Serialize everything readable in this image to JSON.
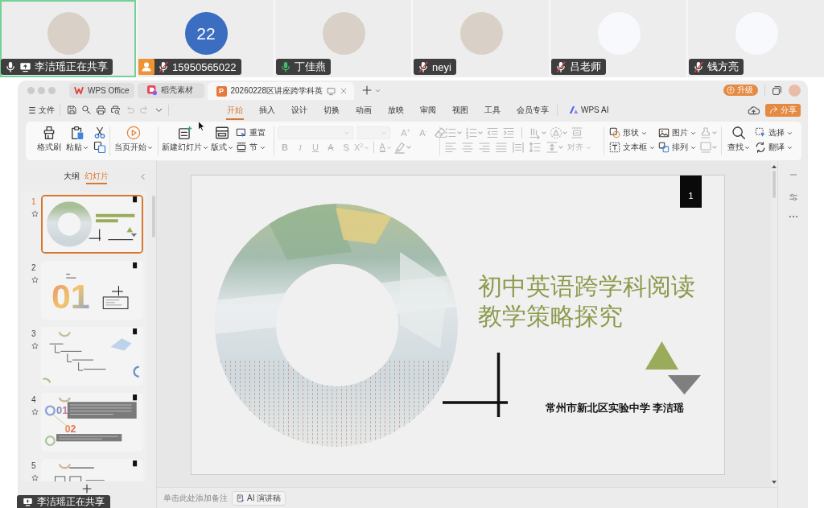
{
  "meeting": {
    "participants": [
      {
        "name": "李洁瑶正在共享",
        "selected": true,
        "badge": false,
        "muted": false,
        "speaking": false,
        "sharing": true,
        "avatar": {
          "kind": "photo"
        }
      },
      {
        "name": "15950565022",
        "selected": false,
        "badge": true,
        "muted": true,
        "speaking": false,
        "sharing": false,
        "avatar": {
          "kind": "initials",
          "text": "22"
        }
      },
      {
        "name": "丁佳燕",
        "selected": false,
        "badge": false,
        "muted": false,
        "speaking": true,
        "sharing": false,
        "avatar": {
          "kind": "photo"
        }
      },
      {
        "name": "neyi",
        "selected": false,
        "badge": false,
        "muted": true,
        "speaking": false,
        "sharing": false,
        "avatar": {
          "kind": "photo"
        }
      },
      {
        "name": "吕老师",
        "selected": false,
        "badge": false,
        "muted": true,
        "speaking": false,
        "sharing": false,
        "avatar": {
          "kind": "cartoon"
        }
      },
      {
        "name": "钱方亮",
        "selected": false,
        "badge": false,
        "muted": true,
        "speaking": false,
        "sharing": false,
        "avatar": {
          "kind": "cartoon"
        }
      }
    ],
    "share_banner": {
      "text": "李洁瑶正在共享"
    }
  },
  "wps": {
    "tabs": [
      {
        "label": "WPS Office",
        "kind": "home",
        "selected": false
      },
      {
        "label": "稻壳素材",
        "kind": "store",
        "selected": false
      },
      {
        "label": "20260228区讲座跨学科英",
        "kind": "document",
        "badge": "P",
        "selected": true
      }
    ],
    "upgrade_button": "升级",
    "file_menu": "文件",
    "menu_tabs": [
      {
        "label": "开始",
        "kind": "plain",
        "selected": true
      },
      {
        "label": "插入",
        "kind": "plain",
        "selected": false
      },
      {
        "label": "设计",
        "kind": "plain",
        "selected": false
      },
      {
        "label": "切换",
        "kind": "plain",
        "selected": false
      },
      {
        "label": "动画",
        "kind": "plain",
        "selected": false
      },
      {
        "label": "放映",
        "kind": "plain",
        "selected": false
      },
      {
        "label": "审阅",
        "kind": "plain",
        "selected": false
      },
      {
        "label": "视图",
        "kind": "plain",
        "selected": false
      },
      {
        "label": "工具",
        "kind": "plain",
        "selected": false
      },
      {
        "label": "会员专享",
        "kind": "plain",
        "selected": false
      },
      {
        "label": "WPS AI",
        "kind": "ai",
        "selected": false
      }
    ],
    "share_button": "分享",
    "ribbon": [
      {
        "kind": "clipboard",
        "disabled": false,
        "buttons": [
          {
            "label": "格式刷",
            "dropdown": false
          },
          {
            "label": "粘贴",
            "dropdown": true
          }
        ]
      },
      {
        "kind": "show",
        "disabled": false,
        "buttons": [
          {
            "label": "当页开始",
            "dropdown": true
          }
        ]
      },
      {
        "kind": "slides",
        "disabled": false,
        "buttons": [
          {
            "label": "新建幻灯片",
            "dropdown": true
          },
          {
            "label": "版式",
            "dropdown": true
          },
          {
            "label": "重置",
            "dropdown": false
          },
          {
            "label": "节",
            "dropdown": true
          }
        ]
      },
      {
        "kind": "font",
        "disabled": true,
        "buttons": [
          {
            "label": "A$^{+}$",
            "kind": "grow",
            "dropdown": false
          },
          {
            "label": "A$^{-}$",
            "kind": "shrink",
            "dropdown": false
          },
          {
            "label": "B",
            "kind": "bold",
            "dropdown": false
          },
          {
            "label": "I",
            "kind": "italic",
            "dropdown": false
          },
          {
            "label": "U",
            "kind": "underline",
            "dropdown": false
          },
          {
            "label": "A",
            "kind": "strike",
            "dropdown": false
          },
          {
            "label": "S",
            "kind": "shadow",
            "dropdown": false
          },
          {
            "label": "X$^{2}$",
            "kind": "superscript",
            "dropdown": true
          },
          {
            "label": "A",
            "kind": "color",
            "dropdown": true
          }
        ]
      },
      {
        "kind": "paragraph",
        "disabled": true,
        "buttons": [
          {
            "label": "对齐",
            "dropdown": true
          }
        ]
      },
      {
        "kind": "insert",
        "disabled": false,
        "buttons": [
          {
            "label": "形状",
            "dropdown": true
          },
          {
            "label": "文本框",
            "dropdown": true
          },
          {
            "label": "图片",
            "dropdown": true
          },
          {
            "label": "排列",
            "dropdown": true
          }
        ]
      },
      {
        "kind": "find",
        "disabled": false,
        "buttons": [
          {
            "label": "查找",
            "dropdown": true
          },
          {
            "label": "选择",
            "dropdown": true
          },
          {
            "label": "翻译",
            "dropdown": true
          }
        ]
      }
    ],
    "panel_tabs": [
      {
        "label": "大纲",
        "selected": false
      },
      {
        "label": "幻灯片",
        "selected": true
      }
    ],
    "slides": [
      {
        "number": "1",
        "kind": "title",
        "selected": true
      },
      {
        "number": "2",
        "kind": "section",
        "numerals": [
          "01"
        ],
        "selected": false
      },
      {
        "number": "3",
        "kind": "outline",
        "selected": false
      },
      {
        "number": "4",
        "kind": "content",
        "numerals": [
          "01",
          "02"
        ],
        "selected": false
      },
      {
        "number": "5",
        "kind": "list",
        "selected": false
      }
    ],
    "slide": {
      "number": "1",
      "title_lines": [
        "初中英语跨学科阅读",
        "教学策略探究"
      ],
      "subtitle": "常州市新北区实验中学 李洁瑶"
    },
    "notes": {
      "placeholder": "单击此处添加备注"
    },
    "ai_script_button": "AI 演讲稿"
  }
}
